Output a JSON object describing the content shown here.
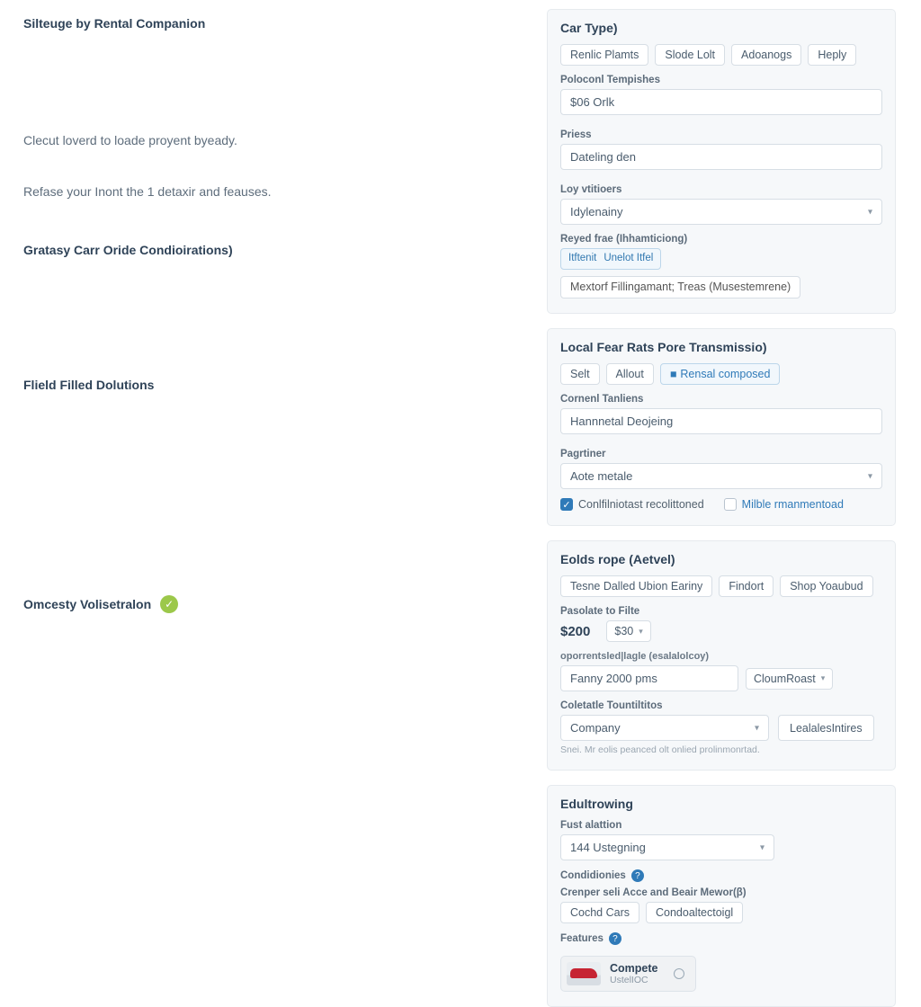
{
  "left": {
    "section1": {
      "heading": "Silteuge by Rental Companion",
      "para1": "Clecut loverd to loade proyent byeady.",
      "para2": "Refase your Inont the 1 detaxir and feauses."
    },
    "section2": {
      "heading": "Gratasy Carr Oride Condioirations)"
    },
    "section3": {
      "heading": "Flield Filled Dolutions"
    },
    "section4": {
      "heading": "Omcesty Volisetralon"
    }
  },
  "panel_cartype": {
    "title": "Car Type)",
    "chips": [
      "Renlic Plamts",
      "Slode Lolt",
      "Adoanogs",
      "Heply"
    ],
    "labels": {
      "templates": "Poloconl Tempishes",
      "prices": "Priess",
      "loy": "Loy vtitioers",
      "reyed": "Reyed frae (Ihhamticiong)"
    },
    "inputs": {
      "templates_value": "$06 Orlk",
      "prices_value": "Dateling den",
      "loy_value": "Idylenainy"
    },
    "reyed_group": {
      "left": "Itftenit",
      "right": "Unelot Itfel"
    },
    "reyed_wide": "Mextorf Fillingamant; Treas (Musestemrene)"
  },
  "panel_local": {
    "title": "Local Fear Rats Pore Transmissio)",
    "chips": {
      "a": "Selt",
      "b": "Allout",
      "c": "Rensal composed"
    },
    "labels": {
      "content": "Cornenl Tanliens",
      "partner": "Pagrtiner"
    },
    "inputs": {
      "content_value": "Hannnetal Deojeing",
      "partner_value": "Aote metale"
    },
    "checks": {
      "a": "Conlfilniotast recolittoned",
      "b": "Milble rmanmentoad"
    }
  },
  "panel_eolds": {
    "title": "Eolds rope (Aetvel)",
    "chips": [
      "Tesne Dalled Ubion Eariny",
      "Findort",
      "Shop Yoaubud"
    ],
    "labels": {
      "pasolate": "Pasolate to Filte",
      "oporen": "oporrentsled|lagle (esalalolcoy)",
      "colct": "Coletatle Tountiltitos"
    },
    "price_static": "$200",
    "price_sel": "$30",
    "oporen_value": "Fanny 2000 pms",
    "oporen_btn": "CloumRoast",
    "colct_value": "Company",
    "lealles_btn": "LealalesIntires",
    "hint": "Snei. Mr eolis peanced olt onlied prolinmonrtad."
  },
  "panel_edut": {
    "title": "Edultrowing",
    "labels": {
      "fust": "Fust alattion",
      "cond": "Condidionies",
      "cren": "Crenper seli Acce and Beair Mewor(β)",
      "feat": "Features"
    },
    "fust_value": "144 Ustegning",
    "cren_chips": [
      "Cochd Cars",
      "Condoaltectoigl"
    ],
    "feature": {
      "title": "Compete",
      "sub": "UstelIOC"
    }
  }
}
